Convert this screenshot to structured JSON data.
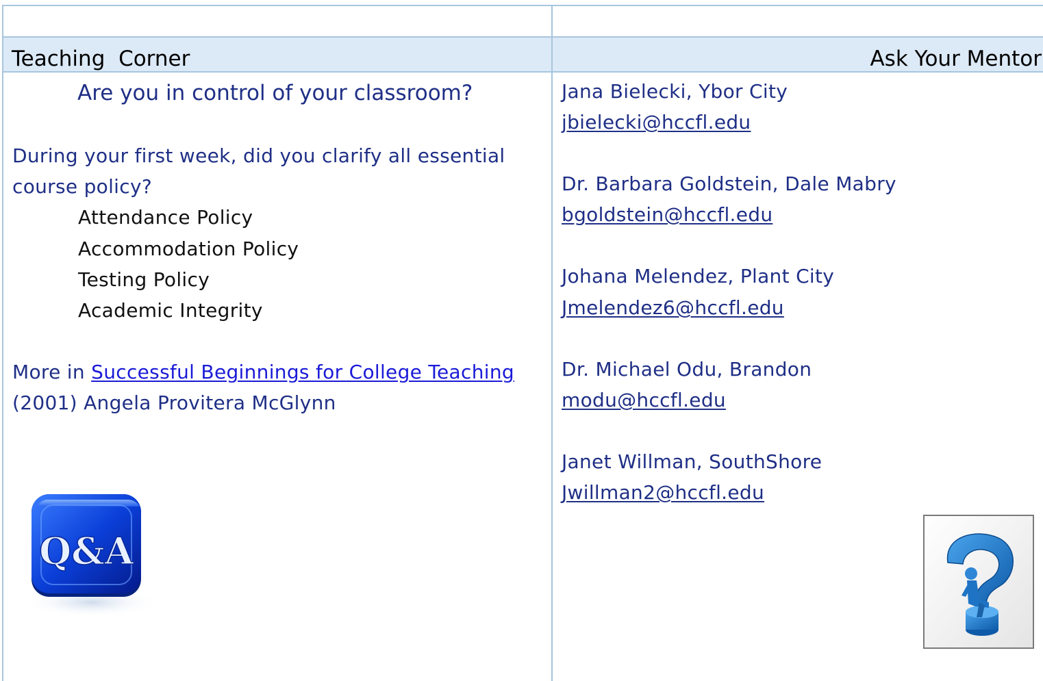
{
  "header": {
    "left_title": "Teaching  Corner",
    "right_title": "Ask Your Mentor"
  },
  "teaching": {
    "question": "Are you in control of your classroom?",
    "intro_line1": "During your first week, did you clarify all essential",
    "intro_line2": "course policy?",
    "policies": [
      "Attendance Policy",
      "Accommodation Policy",
      "Testing Policy",
      "Academic Integrity"
    ],
    "more_prefix": "More in ",
    "book_link": "Successful Beginnings for College Teaching",
    "citation": "(2001) Angela Provitera McGlynn",
    "qa_icon_text": "Q&A"
  },
  "mentors": [
    {
      "name": "Jana Bielecki, Ybor City",
      "email": "jbielecki@hccfl.edu"
    },
    {
      "name": "Dr. Barbara Goldstein, Dale Mabry",
      "email": "bgoldstein@hccfl.edu"
    },
    {
      "name": "Johana Melendez, Plant City",
      "email": "Jmelendez6@hccfl.edu"
    },
    {
      "name": "Dr. Michael Odu, Brandon",
      "email": "modu@hccfl.edu"
    },
    {
      "name": "Janet Willman, SouthShore",
      "email": "Jwillman2@hccfl.edu"
    }
  ],
  "colors": {
    "grid": "#a7c5dd",
    "header_band": "#dce9f6",
    "navy_text": "#1f2f86",
    "link": "#1a1ad8"
  }
}
